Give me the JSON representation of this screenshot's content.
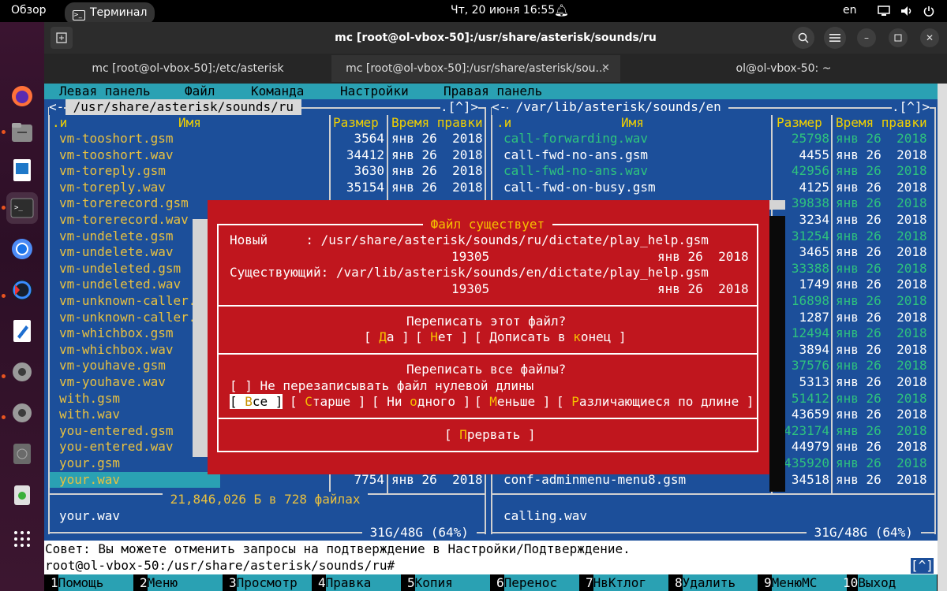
{
  "topbar": {
    "overview": "Обзор",
    "terminal_app": "Терминал",
    "datetime": "Чт, 20 июня  16:55",
    "lang": "en"
  },
  "window": {
    "title": "mc [root@ol-vbox-50]:/usr/share/asterisk/sounds/ru"
  },
  "tabs": [
    {
      "label": "mc [root@ol-vbox-50]:/etc/asterisk"
    },
    {
      "label": "mc [root@ol-vbox-50]:/usr/share/asterisk/sou..."
    },
    {
      "label": "ol@ol-vbox-50: ~"
    }
  ],
  "menubar": {
    "left": "Левая панель",
    "file": "Файл",
    "command": "Команда",
    "settings": "Настройки",
    "right": "Правая панель"
  },
  "left_panel": {
    "path": " /usr/share/asterisk/sounds/ru ",
    "corner_left": "<-",
    "corner_right": ".[^]>",
    "col_n": ".и",
    "col_name": "Имя",
    "col_size": "Размер",
    "col_mtime": "Время правки",
    "rows": [
      {
        "name": "vm-tooshort.gsm",
        "size": "3564",
        "date": "янв 26  2018"
      },
      {
        "name": "vm-tooshort.wav",
        "size": "34412",
        "date": "янв 26  2018"
      },
      {
        "name": "vm-toreply.gsm",
        "size": "3630",
        "date": "янв 26  2018"
      },
      {
        "name": "vm-toreply.wav",
        "size": "35154",
        "date": "янв 26  2018"
      },
      {
        "name": "vm-torerecord.gsm",
        "size": "",
        "date": ""
      },
      {
        "name": "vm-torerecord.wav",
        "size": "",
        "date": ""
      },
      {
        "name": "vm-undelete.gsm",
        "size": "",
        "date": ""
      },
      {
        "name": "vm-undelete.wav",
        "size": "",
        "date": ""
      },
      {
        "name": "vm-undeleted.gsm",
        "size": "",
        "date": ""
      },
      {
        "name": "vm-undeleted.wav",
        "size": "",
        "date": ""
      },
      {
        "name": "vm-unknown-caller.",
        "size": "",
        "date": ""
      },
      {
        "name": "vm-unknown-caller.",
        "size": "",
        "date": ""
      },
      {
        "name": "vm-whichbox.gsm",
        "size": "",
        "date": ""
      },
      {
        "name": "vm-whichbox.wav",
        "size": "",
        "date": ""
      },
      {
        "name": "vm-youhave.gsm",
        "size": "",
        "date": ""
      },
      {
        "name": "vm-youhave.wav",
        "size": "",
        "date": ""
      },
      {
        "name": "with.gsm",
        "size": "",
        "date": ""
      },
      {
        "name": "with.wav",
        "size": "",
        "date": ""
      },
      {
        "name": "you-entered.gsm",
        "size": "",
        "date": ""
      },
      {
        "name": "you-entered.wav",
        "size": "",
        "date": ""
      },
      {
        "name": "your.gsm",
        "size": "",
        "date": ""
      },
      {
        "name": "your.wav",
        "size": "7754",
        "date": "янв 26  2018"
      }
    ],
    "summary": " 21,846,026 Б в 728 файлах ",
    "mini_status": "your.wav",
    "disk": " 31G/48G (64%) "
  },
  "right_panel": {
    "path": " /var/lib/asterisk/sounds/en ",
    "corner_left": "<-",
    "corner_right": ".[^]>",
    "col_n": ".и",
    "col_name": "Имя",
    "col_size": "Размер",
    "col_mtime": "Время правки",
    "rows": [
      {
        "name": "call-forwarding.wav",
        "size": "25798",
        "date": "янв 26  2018",
        "c": "green"
      },
      {
        "name": "call-fwd-no-ans.gsm",
        "size": "4455",
        "date": "янв 26  2018",
        "c": "white"
      },
      {
        "name": "call-fwd-no-ans.wav",
        "size": "42956",
        "date": "янв 26  2018",
        "c": "green"
      },
      {
        "name": "call-fwd-on-busy.gsm",
        "size": "4125",
        "date": "янв 26  2018",
        "c": "white"
      },
      {
        "name": "",
        "size": "39838",
        "date": "янв 26  2018",
        "c": "green"
      },
      {
        "name": "",
        "size": "3234",
        "date": "янв 26  2018",
        "c": "white"
      },
      {
        "name": "",
        "size": "31254",
        "date": "янв 26  2018",
        "c": "green"
      },
      {
        "name": "",
        "size": "3465",
        "date": "янв 26  2018",
        "c": "white"
      },
      {
        "name": "",
        "size": "33388",
        "date": "янв 26  2018",
        "c": "green"
      },
      {
        "name": "",
        "size": "1749",
        "date": "янв 26  2018",
        "c": "white"
      },
      {
        "name": "",
        "size": "16898",
        "date": "янв 26  2018",
        "c": "green"
      },
      {
        "name": "",
        "size": "1287",
        "date": "янв 26  2018",
        "c": "white"
      },
      {
        "name": "",
        "size": "12494",
        "date": "янв 26  2018",
        "c": "green"
      },
      {
        "name": "",
        "size": "3894",
        "date": "янв 26  2018",
        "c": "white"
      },
      {
        "name": "",
        "size": "37576",
        "date": "янв 26  2018",
        "c": "green"
      },
      {
        "name": "",
        "size": "5313",
        "date": "янв 26  2018",
        "c": "white"
      },
      {
        "name": "",
        "size": "51412",
        "date": "янв 26  2018",
        "c": "green"
      },
      {
        "name": "",
        "size": "43659",
        "date": "янв 26  2018",
        "c": "white"
      },
      {
        "name": "",
        "size": "423174",
        "date": "янв 26  2018",
        "c": "green"
      },
      {
        "name": "",
        "size": "44979",
        "date": "янв 26  2018",
        "c": "white"
      },
      {
        "name": "",
        "size": "435920",
        "date": "янв 26  2018",
        "c": "green"
      },
      {
        "name": "conf-adminmenu-menu8.gsm",
        "size": "34518",
        "date": "янв 26  2018",
        "c": "white"
      }
    ],
    "mini_status": "calling.wav",
    "disk": " 31G/48G (64%) "
  },
  "dialog": {
    "title": " Файл существует ",
    "new_line": "Новый     : /usr/share/asterisk/sounds/ru/dictate/play_help.gsm",
    "new_size": "19305",
    "new_date": "янв 26  2018",
    "existing_line": "Существующий: /var/lib/asterisk/sounds/en/dictate/play_help.gsm",
    "existing_size": "19305",
    "existing_date": "янв 26  2018",
    "q1": "Переписать этот файл?",
    "q2": "Переписать все файлы?",
    "checkbox": "[ ] Не перезаписывать файл нулевой длины",
    "btn_yes_pre": "[ ",
    "btn_yes_hot": "Д",
    "btn_yes_post": "а ]",
    "btn_no_pre": "[ ",
    "btn_no_hot": "Н",
    "btn_no_post": "ет ]",
    "btn_append_pre": "[ Дописать в ",
    "btn_append_hot": "к",
    "btn_append_post": "онец ]",
    "btn_all_pre": "[ ",
    "btn_all_hot": "В",
    "btn_all_post": "се ]",
    "btn_older_pre": "[ ",
    "btn_older_hot": "С",
    "btn_older_post": "тарше ]",
    "btn_none_pre": "[ Ни ",
    "btn_none_hot": "о",
    "btn_none_post": "дного ]",
    "btn_smaller_pre": "[ ",
    "btn_smaller_hot": "М",
    "btn_smaller_post": "еньше ]",
    "btn_diff_pre": "[ ",
    "btn_diff_hot": "Р",
    "btn_diff_post": "азличающиеся по длине ]",
    "btn_abort_pre": "[ ",
    "btn_abort_hot": "П",
    "btn_abort_post": "рервать ]"
  },
  "hint": "Совет: Вы можете отменить запросы на подтверждение в Настройки/Подтверждение.",
  "prompt": "root@ol-vbox-50:/usr/share/asterisk/sounds/ru#",
  "prompt_corner": "[^]",
  "fkeys": [
    {
      "n": "1",
      "l": "Помощь"
    },
    {
      "n": "2",
      "l": "Меню"
    },
    {
      "n": "3",
      "l": "Просмотр"
    },
    {
      "n": "4",
      "l": "Правка"
    },
    {
      "n": "5",
      "l": "Копия"
    },
    {
      "n": "6",
      "l": "Перенос"
    },
    {
      "n": "7",
      "l": "НвКтлог"
    },
    {
      "n": "8",
      "l": "Удалить"
    },
    {
      "n": "9",
      "l": "МенюMC"
    },
    {
      "n": "10",
      "l": "Выход"
    }
  ],
  "colors": {
    "panel": "#1c4f9a",
    "dialog": "#c0161e",
    "accent": "#e95420"
  }
}
